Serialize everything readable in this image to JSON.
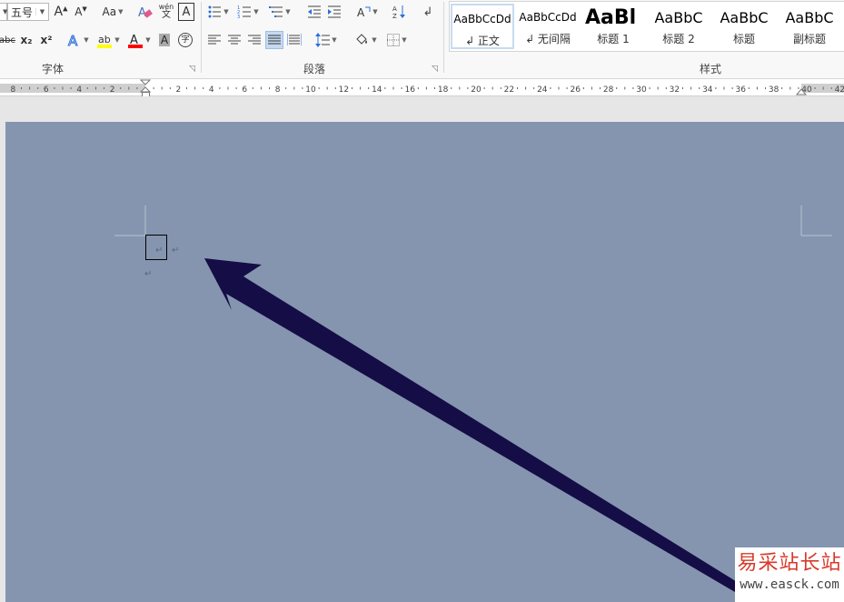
{
  "ribbon": {
    "font_group": {
      "label": "字体",
      "font_size_value": "五号",
      "change_case_label": "Aa",
      "phonetic_label": "wén",
      "clear_label": "A",
      "bold_abc": "abc",
      "subscript_label": "x₂",
      "superscript_label": "x²"
    },
    "paragraph_group": {
      "label": "段落"
    },
    "styles_group": {
      "label": "样式",
      "items": [
        {
          "preview": "AaBbCcDd",
          "name": "↲ 正文"
        },
        {
          "preview": "AaBbCcDd",
          "name": "↲ 无间隔"
        },
        {
          "preview": "AaBl",
          "name": "标题 1"
        },
        {
          "preview": "AaBbC",
          "name": "标题 2"
        },
        {
          "preview": "AaBbC",
          "name": "标题"
        },
        {
          "preview": "AaBbC",
          "name": "副标题"
        }
      ]
    }
  },
  "ruler": {
    "left_numbers": [
      "8",
      "6",
      "4",
      "2"
    ],
    "right_numbers": [
      "2",
      "4",
      "6",
      "8",
      "10",
      "12",
      "14",
      "16",
      "18",
      "20",
      "22",
      "24",
      "26",
      "28",
      "30",
      "32",
      "34",
      "36",
      "38",
      "40",
      "42"
    ]
  },
  "document": {
    "paragraph_mark": "↵",
    "page_color": "#8595af",
    "arrow_color": "#150d45"
  },
  "watermark": {
    "title": "易采站长站",
    "url": "www.easck.com"
  },
  "colors": {
    "highlight": "#ffff00",
    "font_color": "#ff0000",
    "accent": "#2b579a"
  }
}
